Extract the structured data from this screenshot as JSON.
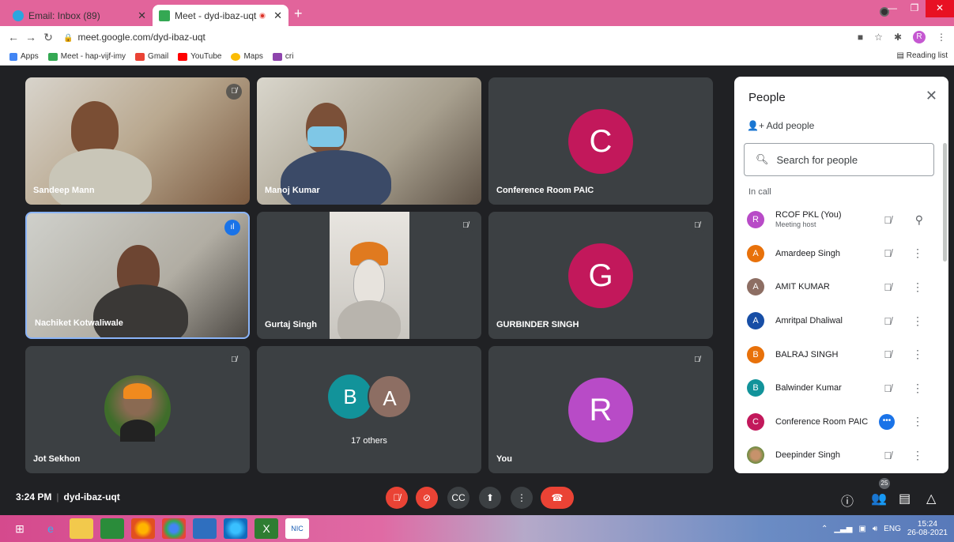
{
  "browser": {
    "tabs": [
      {
        "title": "Email: Inbox (89)",
        "active": false
      },
      {
        "title": "Meet - dyd-ibaz-uqt",
        "active": true
      }
    ],
    "url": "meet.google.com/dyd-ibaz-uqt",
    "profile_initial": "R",
    "bookmarks": [
      "Apps",
      "Meet - hap-vijf-imy",
      "Gmail",
      "YouTube",
      "Maps",
      "cri"
    ],
    "reading_list": "Reading list"
  },
  "tiles": [
    {
      "name": "Sandeep Mann",
      "muted": true
    },
    {
      "name": "Manoj Kumar",
      "muted": false
    },
    {
      "name": "Conference Room PAIC",
      "initial": "C",
      "color": "#c2185b"
    },
    {
      "name": "Nachiket Kotwaliwale",
      "speaking": true
    },
    {
      "name": "Gurtaj Singh",
      "muted": true
    },
    {
      "name": "GURBINDER SINGH",
      "initial": "G",
      "color": "#c2185b",
      "muted": true
    },
    {
      "name": "Jot Sekhon",
      "muted": true
    },
    {
      "name": "17 others",
      "initials": [
        "B",
        "A"
      ]
    },
    {
      "name": "You",
      "initial": "R",
      "color": "#b84bc7",
      "muted": true
    }
  ],
  "people_panel": {
    "title": "People",
    "add_people": "Add people",
    "search_placeholder": "Search for people",
    "section": "In call",
    "participants": [
      {
        "name": "RCOF PKL (You)",
        "sub": "Meeting host",
        "initial": "R",
        "color": "#b84bc7"
      },
      {
        "name": "Amardeep Singh",
        "initial": "A",
        "color": "#e8710a"
      },
      {
        "name": "AMIT KUMAR",
        "initial": "A",
        "color": "#8d6e63"
      },
      {
        "name": "Amritpal Dhaliwal",
        "initial": "A",
        "color": "#174ea6"
      },
      {
        "name": "BALRAJ SINGH",
        "initial": "B",
        "color": "#e8710a"
      },
      {
        "name": "Balwinder Kumar",
        "initial": "B",
        "color": "#12939a"
      },
      {
        "name": "Conference Room PAIC",
        "initial": "C",
        "color": "#c2185b"
      },
      {
        "name": "Deepinder Singh",
        "initial": "",
        "color": "#a0522d"
      }
    ]
  },
  "bottom": {
    "time": "3:24 PM",
    "meeting_code": "dyd-ibaz-uqt",
    "participant_count": "25"
  },
  "taskbar": {
    "lang": "ENG",
    "time": "15:24",
    "date": "26-08-2021"
  }
}
